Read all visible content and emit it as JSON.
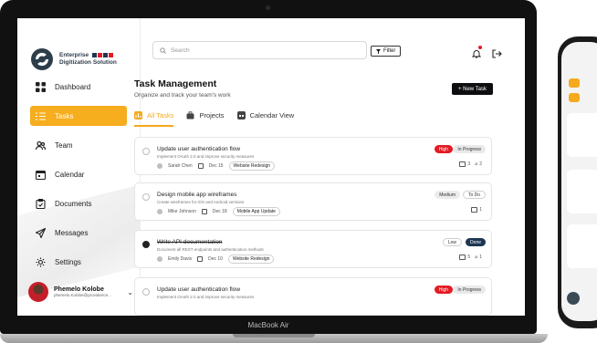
{
  "device": {
    "label": "MacBook Air"
  },
  "brand": {
    "line1": "Enterprise",
    "line2": "Digitization Solution",
    "flag_colors": [
      "#1e3552",
      "#e31b23",
      "#1e3552",
      "#e31b23"
    ]
  },
  "sidebar": {
    "items": [
      {
        "label": "Dashboard",
        "icon": "grid-icon",
        "active": false
      },
      {
        "label": "Tasks",
        "icon": "list-icon",
        "active": true
      },
      {
        "label": "Team",
        "icon": "users-icon",
        "active": false
      },
      {
        "label": "Calendar",
        "icon": "calendar-icon",
        "active": false
      },
      {
        "label": "Documents",
        "icon": "clipboard-icon",
        "active": false
      },
      {
        "label": "Messages",
        "icon": "send-icon",
        "active": false
      },
      {
        "label": "Settings",
        "icon": "gear-icon",
        "active": false
      }
    ]
  },
  "user": {
    "name": "Phemelo Kolobe",
    "email": "phemelo.Kolobe@providence..."
  },
  "header": {
    "search_placeholder": "Search",
    "filter_label": "Filter"
  },
  "page": {
    "title": "Task Management",
    "subtitle": "Organize and track your team's work",
    "new_task_label": "+ New Task"
  },
  "tabs": [
    {
      "label": "All Tasks",
      "active": true
    },
    {
      "label": "Projects",
      "active": false
    },
    {
      "label": "Calendar View",
      "active": false
    }
  ],
  "tasks": [
    {
      "title": "Update user authentication flow",
      "description": "Implement OAuth 2.0 and improve security measures",
      "assignee": "Sarah Chen",
      "date": "Dec 15",
      "project": "Website Redesign",
      "priority": "High",
      "status": "In Progress",
      "comments": "3",
      "attachments": "2",
      "completed": false
    },
    {
      "title": "Design mobile app wireframes",
      "description": "Create wireframes for iOS and Android versions",
      "assignee": "Mike Johnson",
      "date": "Dec 18",
      "project": "Mobile App Update",
      "priority": "Medium",
      "status": "To Do",
      "comments": "1",
      "attachments": "",
      "completed": false
    },
    {
      "title": "Write API documentation",
      "description": "Document all REST endpoints and authentication methods",
      "assignee": "Emily Davis",
      "date": "Dec 10",
      "project": "Website Redesign",
      "priority": "Low",
      "status": "Done",
      "comments": "5",
      "attachments": "1",
      "completed": true
    },
    {
      "title": "Update user authentication flow",
      "description": "Implement OAuth 2.0 and improve security measures",
      "priority": "High",
      "status": "In Progress",
      "completed": false
    }
  ],
  "colors": {
    "accent": "#f5a91d",
    "danger": "#e31b23",
    "navy": "#1e3552"
  }
}
